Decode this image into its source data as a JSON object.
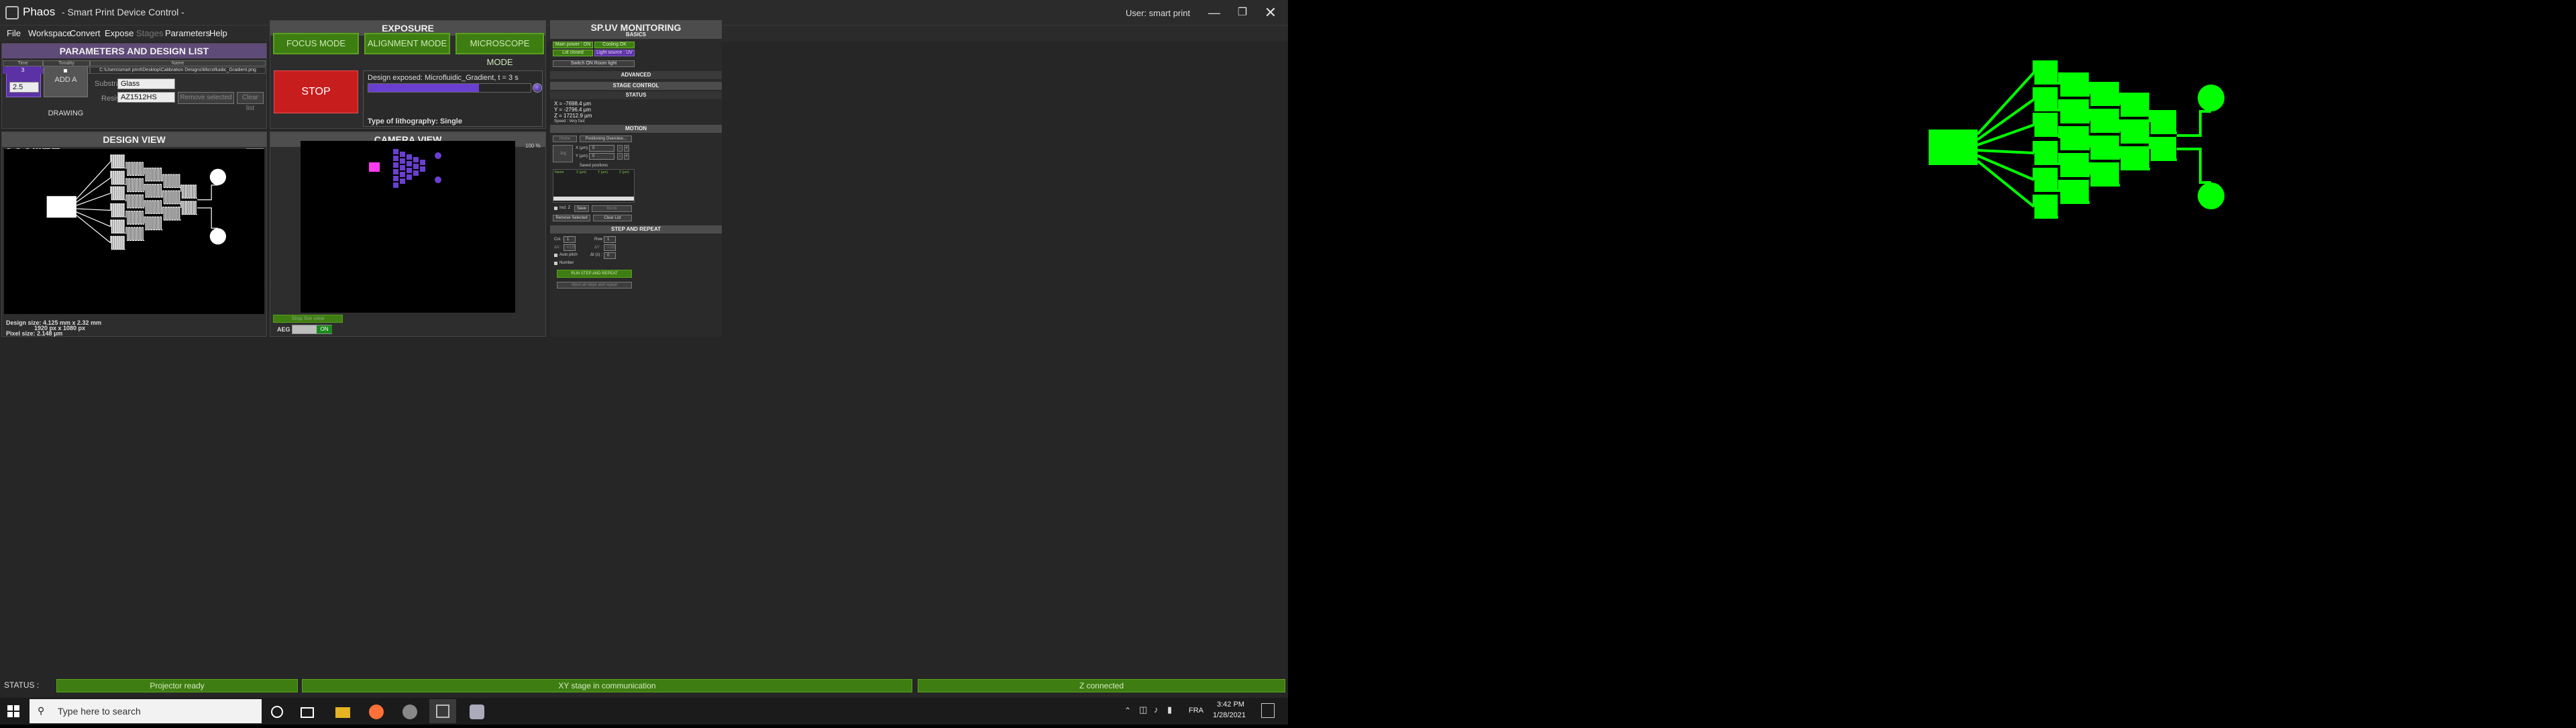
{
  "window": {
    "app_name": "Phaos",
    "title": "- Smart Print Device Control -",
    "user": "User: smart print"
  },
  "menu": [
    "File",
    "Workspace",
    "Convert",
    "Expose",
    "Stages",
    "Parameters",
    "Help"
  ],
  "params": {
    "header": "PARAMETERS AND DESIGN LIST",
    "objective_label": "OBJECTIVE",
    "objective_value": "2.5",
    "add_drawing_label": "ADD A DRAWING",
    "substrate_label": "Substrate",
    "substrate_value": "Glass",
    "resist_label": "Resist",
    "resist_value": "AZ1512HS",
    "btn_a": "Remove selected",
    "btn_b": "Clear list",
    "table_headers": [
      "Time",
      "Tonality",
      "Name"
    ],
    "table_row": {
      "time": "3",
      "name": "C:\\Users\\smart print\\Desktop\\Calibration Designs\\Microfluidic_Gradient.png"
    }
  },
  "exposure": {
    "header": "EXPOSURE",
    "focus_mode": "FOCUS MODE",
    "alignment_mode": "ALIGNMENT MODE",
    "microscope_mode": "MICROSCOPE MODE",
    "stop": "STOP",
    "design_exposed": "Design exposed: Microfluidic_Gradient, t = 3 s",
    "progress": 0.68,
    "litho_type": "Type of lithography: Single"
  },
  "design_view": {
    "header": "DESIGN VIEW",
    "zoom_select": "475",
    "design_size": "Design size: 4.125 mm x 2.32 mm",
    "pixel_dims": "1920 px x 1080 px",
    "pixel_size": "Pixel size: 2.148 µm"
  },
  "camera_view": {
    "header": "CAMERA VIEW",
    "zoom": "100 %",
    "stop_live": "Stop live view",
    "aeg_label": "AEG",
    "aeg_state": "ON"
  },
  "monitoring": {
    "header": "SP.UV MONITORING",
    "basics": "BASICS",
    "main_power": "Main power : ON",
    "cooling": "Cooling OK",
    "lid": "Lid closed",
    "light_source": "Light source : UV",
    "room_light": "Switch ON Room light",
    "advanced": "ADVANCED"
  },
  "stage": {
    "header": "STAGE CONTROL",
    "status": "STATUS",
    "x": "X = -7698.4 µm",
    "y": "Y = -2796.4 µm",
    "z": "Z = 17212.9 µm",
    "speed": "Speed : Very fast",
    "motion": "MOTION",
    "home": "Home",
    "positioning_overview": "Positioning Overview...",
    "jog": "Jog",
    "x_um_label": "X (µm) :",
    "x_um_value": "0",
    "y_um_label": "Y (µm) :",
    "y_um_value": "0",
    "saved_positions": "Saved positions",
    "pos_headers": [
      "Name",
      "X (µm)",
      "Y (µm)",
      "Z (µm)"
    ],
    "incl_z": "Incl. Z",
    "save": "Save",
    "goto": "Go to",
    "remove_selected": "Remove Selected",
    "clear_list": "Clear List"
  },
  "step": {
    "header": "STEP AND REPEAT",
    "col_label": "Col. :",
    "col_value": "1",
    "row_label": "Row :",
    "row_value": "1",
    "dx_label": "ΔX :",
    "dx_value": "4.125",
    "dy_label": "ΔY :",
    "dy_value": "2.320",
    "auto_pitch": "Auto pitch",
    "dt_label": "Δt (s) :",
    "dt_value": "0",
    "number": "Number",
    "run": "RUN STEP AND REPEAT",
    "abort": "Abort all steps and repeat"
  },
  "status": {
    "label": "STATUS :",
    "projector": "Projector ready",
    "xy": "XY stage in communication",
    "z": "Z connected"
  },
  "taskbar": {
    "search_placeholder": "Type here to search",
    "lang": "FRA",
    "time": "3:42 PM",
    "date": "1/28/2021"
  },
  "colors": {
    "projector_green": "#00ff00",
    "camera_magenta": "#ff3cf0",
    "camera_purple": "#6a3fd0",
    "status_green": "#3e7d12",
    "stop_red": "#c81d1d"
  }
}
